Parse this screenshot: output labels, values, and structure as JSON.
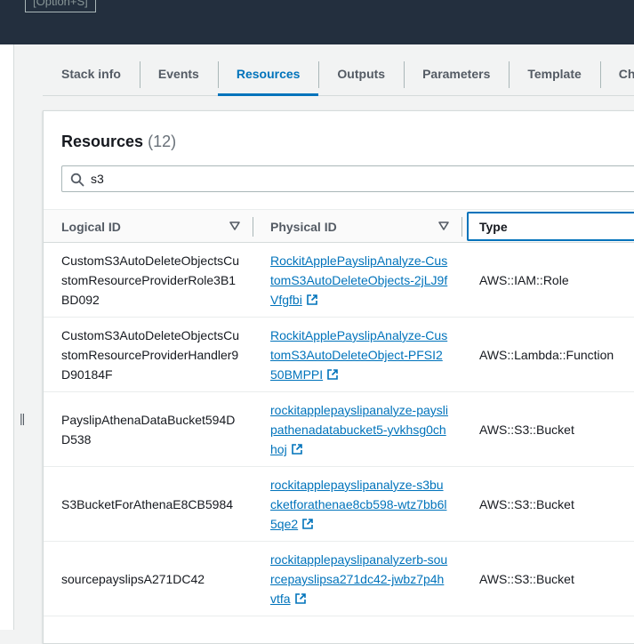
{
  "top": {
    "option_chip": "[Option+S]"
  },
  "tabs": [
    {
      "label": "Stack info",
      "active": false
    },
    {
      "label": "Events",
      "active": false
    },
    {
      "label": "Resources",
      "active": true
    },
    {
      "label": "Outputs",
      "active": false
    },
    {
      "label": "Parameters",
      "active": false
    },
    {
      "label": "Template",
      "active": false
    },
    {
      "label": "Cha",
      "active": false
    }
  ],
  "resources": {
    "title": "Resources",
    "count": "(12)",
    "search": {
      "value": "s3",
      "icon": "search-icon"
    },
    "columns": {
      "logical": "Logical ID",
      "physical": "Physical ID",
      "type": "Type"
    },
    "rows": [
      {
        "logical": "CustomS3AutoDeleteObjectsCustomResourceProviderRole3B1BD092",
        "physical": "RockitApplePayslipAnalyze-CustomS3AutoDeleteObjects-2jLJ9fVfgfbi",
        "type": "AWS::IAM::Role"
      },
      {
        "logical": "CustomS3AutoDeleteObjectsCustomResourceProviderHandler9D90184F",
        "physical": "RockitApplePayslipAnalyze-CustomS3AutoDeleteObject-PFSI250BMPPI",
        "type": "AWS::Lambda::Function"
      },
      {
        "logical": "PayslipAthenaDataBucket594DD538",
        "physical": "rockitapplepayslipanalyze-payslipathenadatabucket5-yvkhsg0chhoj",
        "type": "AWS::S3::Bucket"
      },
      {
        "logical": "S3BucketForAthenaE8CB5984",
        "physical": "rockitapplepayslipanalyze-s3bucketforathenae8cb598-wtz7bb6l5qe2",
        "type": "AWS::S3::Bucket"
      },
      {
        "logical": "sourcepayslipsA271DC42",
        "physical": "rockitapplepayslipanalyzerb-sourcepayslipsa271dc42-jwbz7p4hvtfa",
        "type": "AWS::S3::Bucket"
      }
    ]
  },
  "colors": {
    "topbar": "#232f3e",
    "accent": "#0073bb",
    "link": "#0073bb"
  }
}
